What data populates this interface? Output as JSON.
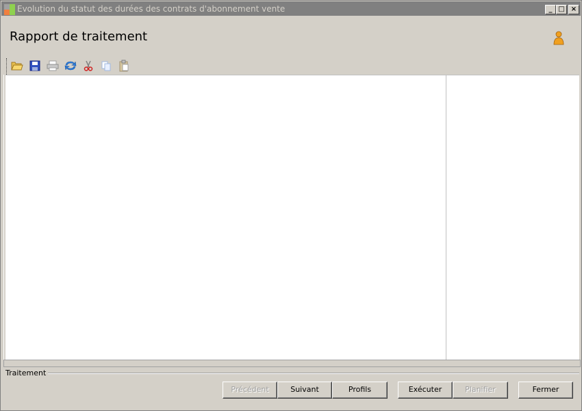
{
  "window": {
    "title": "Evolution du statut des durées des contrats d'abonnement vente",
    "controls": {
      "minimize": "_",
      "maximize": "□",
      "close": "×"
    }
  },
  "header": {
    "title": "Rapport de traitement",
    "user_icon": "user-icon"
  },
  "toolbar": {
    "items": [
      {
        "name": "open",
        "icon": "folder-open-icon",
        "enabled": true
      },
      {
        "name": "save",
        "icon": "save-icon",
        "enabled": true
      },
      {
        "name": "print",
        "icon": "printer-icon",
        "enabled": false
      },
      {
        "name": "refresh",
        "icon": "refresh-icon",
        "enabled": true
      },
      {
        "name": "cut",
        "icon": "scissors-icon",
        "enabled": true
      },
      {
        "name": "copy",
        "icon": "copy-icon",
        "enabled": false
      },
      {
        "name": "paste",
        "icon": "paste-icon",
        "enabled": false
      }
    ]
  },
  "status": {
    "group_label": "Traitement"
  },
  "buttons": {
    "previous": "Précédent",
    "next": "Suivant",
    "profiles": "Profils",
    "execute": "Exécuter",
    "schedule": "Planifier",
    "close": "Fermer"
  },
  "colors": {
    "titlebar": "#808080",
    "face": "#d4d0c8",
    "accent_orange": "#f0a020"
  }
}
